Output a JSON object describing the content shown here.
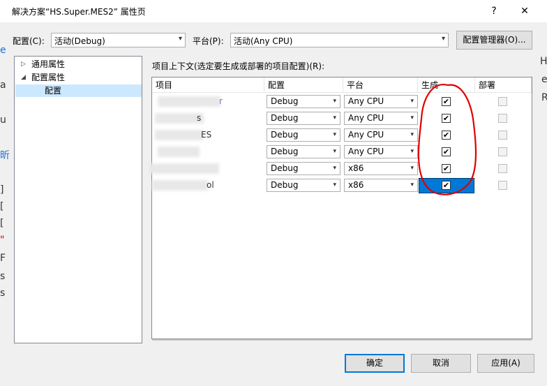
{
  "window": {
    "title": "解决方案“HS.Super.MES2” 属性页",
    "help": "?",
    "close": "✕"
  },
  "top": {
    "config_label": "配置(C):",
    "config_value": "活动(Debug)",
    "platform_label": "平台(P):",
    "platform_value": "活动(Any CPU)",
    "manager_button": "配置管理器(O)..."
  },
  "tree": {
    "items": [
      {
        "label": "通用属性",
        "toggle": "▷"
      },
      {
        "label": "配置属性",
        "toggle": "◢"
      },
      {
        "label": "配置",
        "toggle": ""
      }
    ]
  },
  "grid": {
    "caption": "项目上下文(选定要生成或部署的项目配置)(R):",
    "headers": [
      "项目",
      "配置",
      "平台",
      "生成",
      "部署"
    ],
    "rows": [
      {
        "name": "r",
        "config": "Debug",
        "platform": "Any CPU",
        "build": "✔",
        "deploy": ""
      },
      {
        "name": "s",
        "config": "Debug",
        "platform": "Any CPU",
        "build": "✔",
        "deploy": ""
      },
      {
        "name": "ES",
        "config": "Debug",
        "platform": "Any CPU",
        "build": "✔",
        "deploy": ""
      },
      {
        "name": "",
        "config": "Debug",
        "platform": "Any CPU",
        "build": "✔",
        "deploy": ""
      },
      {
        "name": "",
        "config": "Debug",
        "platform": "x86",
        "build": "✔",
        "deploy": ""
      },
      {
        "name": "ol",
        "config": "Debug",
        "platform": "x86",
        "build": "✔",
        "deploy": ""
      }
    ]
  },
  "buttons": {
    "ok": "确定",
    "cancel": "取消",
    "apply": "应用(A)"
  },
  "background": {
    "left_glyphs": [
      "e",
      "a",
      "u",
      "昕",
      "]",
      "[",
      "[",
      "\"",
      "F",
      "s",
      "s"
    ],
    "right_glyphs": [
      "H",
      "e",
      "R"
    ]
  },
  "colors": {
    "accent": "#0078d7",
    "annotation": "#e00000"
  }
}
